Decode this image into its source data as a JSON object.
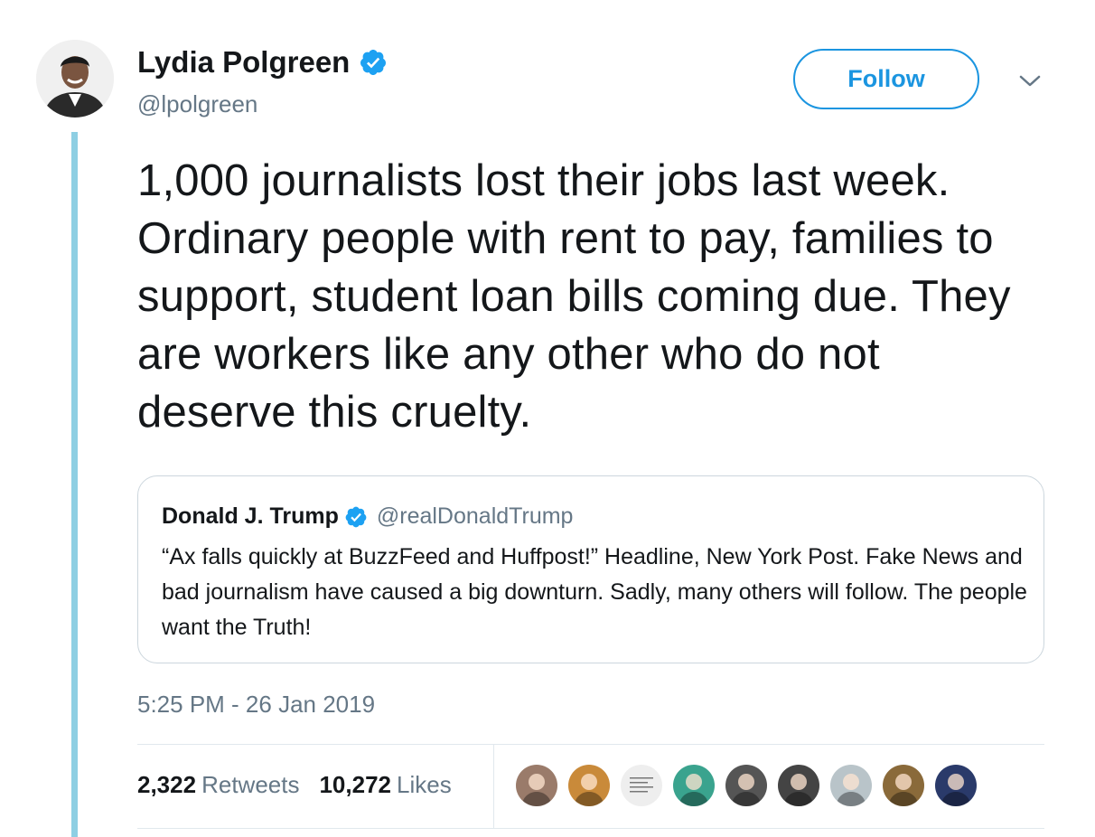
{
  "author": {
    "name": "Lydia Polgreen",
    "handle": "@lpolgreen",
    "verified": true,
    "avatar": "author-avatar"
  },
  "actions": {
    "follow_label": "Follow",
    "menu_icon": "chevron-down-icon"
  },
  "tweet": {
    "text": "1,000 journalists lost their jobs last week. Ordinary people with rent to pay, families to support, student loan bills coming due. They are workers like any other who do not deserve this cruelty.",
    "timestamp": "5:25 PM - 26 Jan 2019"
  },
  "quoted_tweet": {
    "name": "Donald J. Trump",
    "handle": "@realDonaldTrump",
    "verified": true,
    "text": "“Ax falls quickly at BuzzFeed and Huffpost!” Headline, New York Post. Fake News and bad journalism have caused a big downturn. Sadly, many others will follow. The people want the Truth!"
  },
  "stats": {
    "retweets_count": "2,322",
    "retweets_label": "Retweets",
    "likes_count": "10,272",
    "likes_label": "Likes"
  },
  "likers": [
    {
      "icon": "liker-avatar-1",
      "color": "#9a7b6a"
    },
    {
      "icon": "liker-avatar-2",
      "color": "#c98a3a"
    },
    {
      "icon": "liker-avatar-3",
      "color": "#eeeeee"
    },
    {
      "icon": "liker-avatar-4",
      "color": "#3aa38e"
    },
    {
      "icon": "liker-avatar-5",
      "color": "#555555"
    },
    {
      "icon": "liker-avatar-6",
      "color": "#444444"
    },
    {
      "icon": "liker-avatar-7",
      "color": "#b9c4c9"
    },
    {
      "icon": "liker-avatar-8",
      "color": "#8a6a3a"
    },
    {
      "icon": "liker-avatar-9",
      "color": "#2a3a6a"
    }
  ],
  "colors": {
    "accent": "#1b95e0",
    "verified": "#1da1f2",
    "thread_line": "#8ecfe3",
    "secondary_text": "#657786",
    "border": "#ccd6dd"
  }
}
